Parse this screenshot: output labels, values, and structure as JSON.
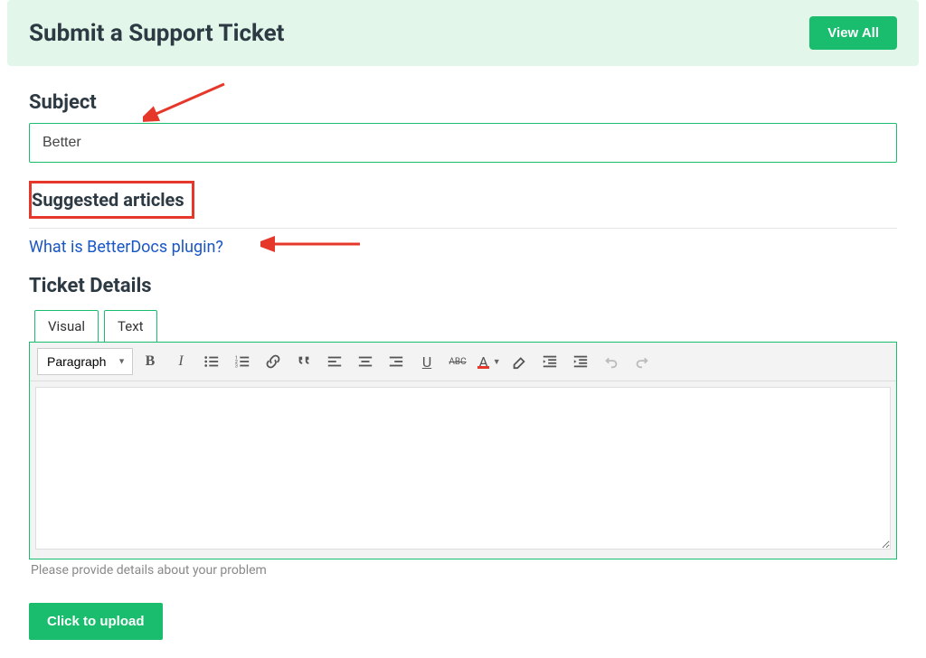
{
  "header": {
    "title": "Submit a Support Ticket",
    "view_all": "View All"
  },
  "subject": {
    "label": "Subject",
    "value": "Better"
  },
  "suggested": {
    "title": "Suggested articles",
    "articles": [
      "What is BetterDocs plugin?"
    ]
  },
  "details": {
    "heading": "Ticket Details",
    "tabs": {
      "visual": "Visual",
      "text": "Text"
    },
    "format_select": "Paragraph",
    "helper": "Please provide details about your problem"
  },
  "upload": {
    "label": "Click to upload"
  },
  "toolbar_icons": {
    "bold": "B",
    "italic": "I",
    "underline": "U",
    "strike": "ABC",
    "textcolor": "A"
  },
  "annotation_color": "#e6382a"
}
